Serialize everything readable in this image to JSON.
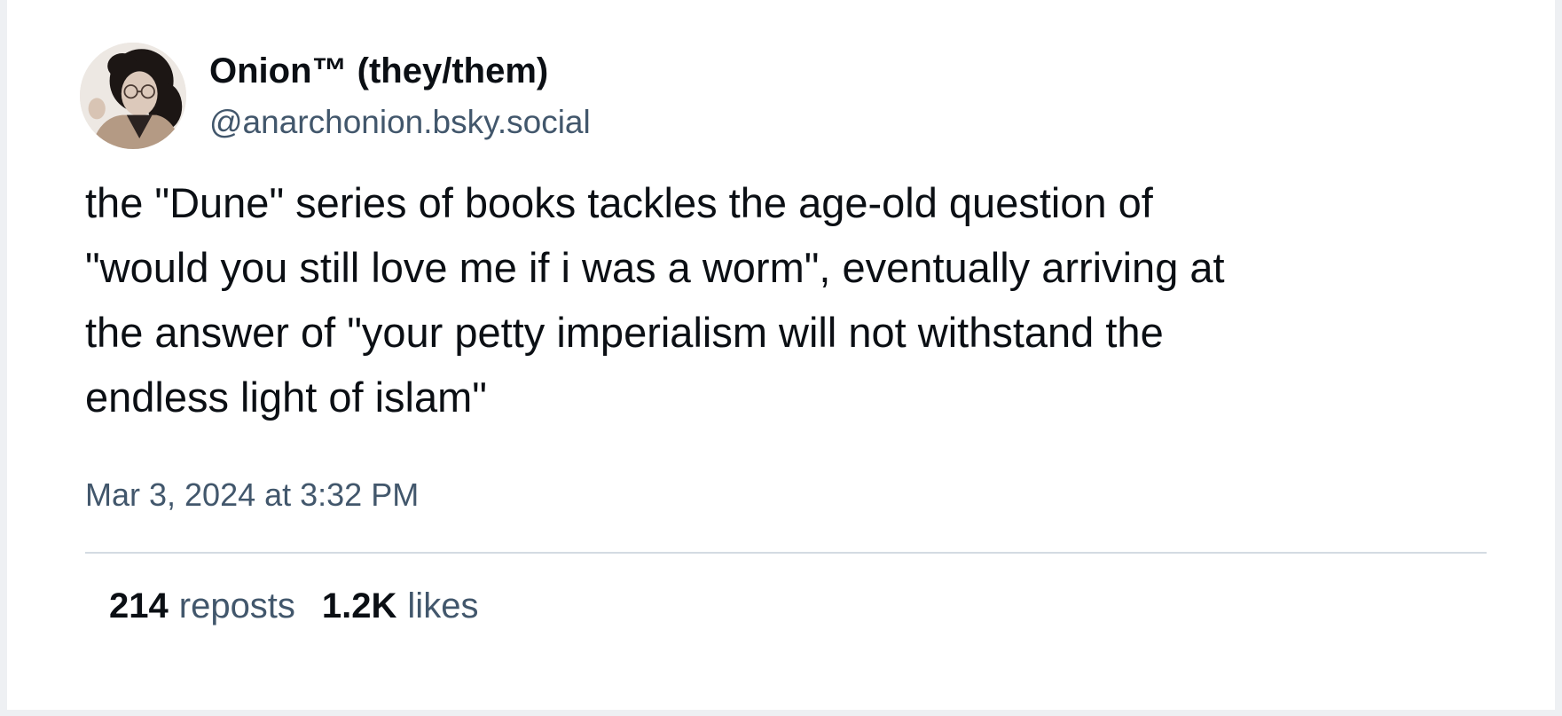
{
  "post": {
    "author": {
      "display_name": "Onion™ (they/them)",
      "handle": "@anarchonion.bsky.social"
    },
    "text_lines": [
      "the \"Dune\" series of books tackles the age-old question of",
      "\"would you still love me if i was a worm\", eventually arriving at",
      "the answer of \"your petty imperialism will not withstand the",
      "endless light of islam\""
    ],
    "timestamp": "Mar 3, 2024 at 3:32 PM",
    "stats": {
      "reposts_count": "214",
      "reposts_label": "reposts",
      "likes_count": "1.2K",
      "likes_label": "likes"
    }
  }
}
